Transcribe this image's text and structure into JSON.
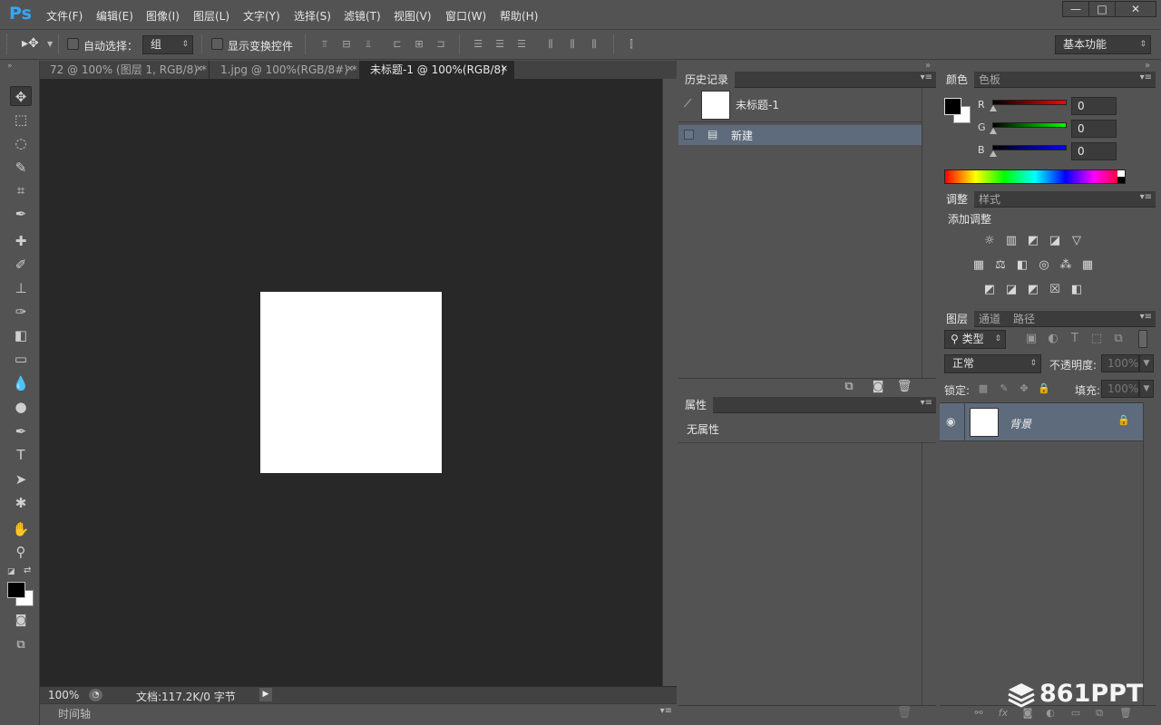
{
  "app": {
    "logo": "Ps"
  },
  "menu": [
    "文件(F)",
    "编辑(E)",
    "图像(I)",
    "图层(L)",
    "文字(Y)",
    "选择(S)",
    "滤镜(T)",
    "视图(V)",
    "窗口(W)",
    "帮助(H)"
  ],
  "window_controls": {
    "minimize": "—",
    "maximize": "□",
    "close": "✕"
  },
  "options": {
    "auto_select_label": "自动选择：",
    "auto_select_value": "组",
    "transform_label": "显示变换控件",
    "workspace": "基本功能"
  },
  "tabs": [
    {
      "label": "72 @ 100% (图层 1, RGB/8) *",
      "active": false
    },
    {
      "label": "1.jpg @ 100%(RGB/8#) *",
      "active": false
    },
    {
      "label": "未标题-1 @ 100%(RGB/8)",
      "active": true
    }
  ],
  "status": {
    "zoom": "100%",
    "doc_info": "文档:117.2K/0 字节"
  },
  "timeline": {
    "label": "时间轴"
  },
  "history": {
    "tab": "历史记录",
    "snapshot": "未标题-1",
    "step": "新建"
  },
  "properties": {
    "tab": "属性",
    "empty": "无属性"
  },
  "color": {
    "tabs": [
      "颜色",
      "色板"
    ],
    "r_label": "R",
    "g_label": "G",
    "b_label": "B",
    "r": "0",
    "g": "0",
    "b": "0",
    "foreground": "#000000",
    "background": "#ffffff"
  },
  "adjustments": {
    "tabs": [
      "调整",
      "样式"
    ],
    "heading": "添加调整"
  },
  "layers": {
    "tabs": [
      "图层",
      "通道",
      "路径"
    ],
    "filter_type": "类型",
    "blend_mode": "正常",
    "opacity_label": "不透明度:",
    "opacity": "100%",
    "lock_label": "锁定:",
    "fill_label": "填充:",
    "fill": "100%",
    "layer_name": "背景"
  },
  "watermark": "861PPT",
  "accent": "#31a8ff"
}
